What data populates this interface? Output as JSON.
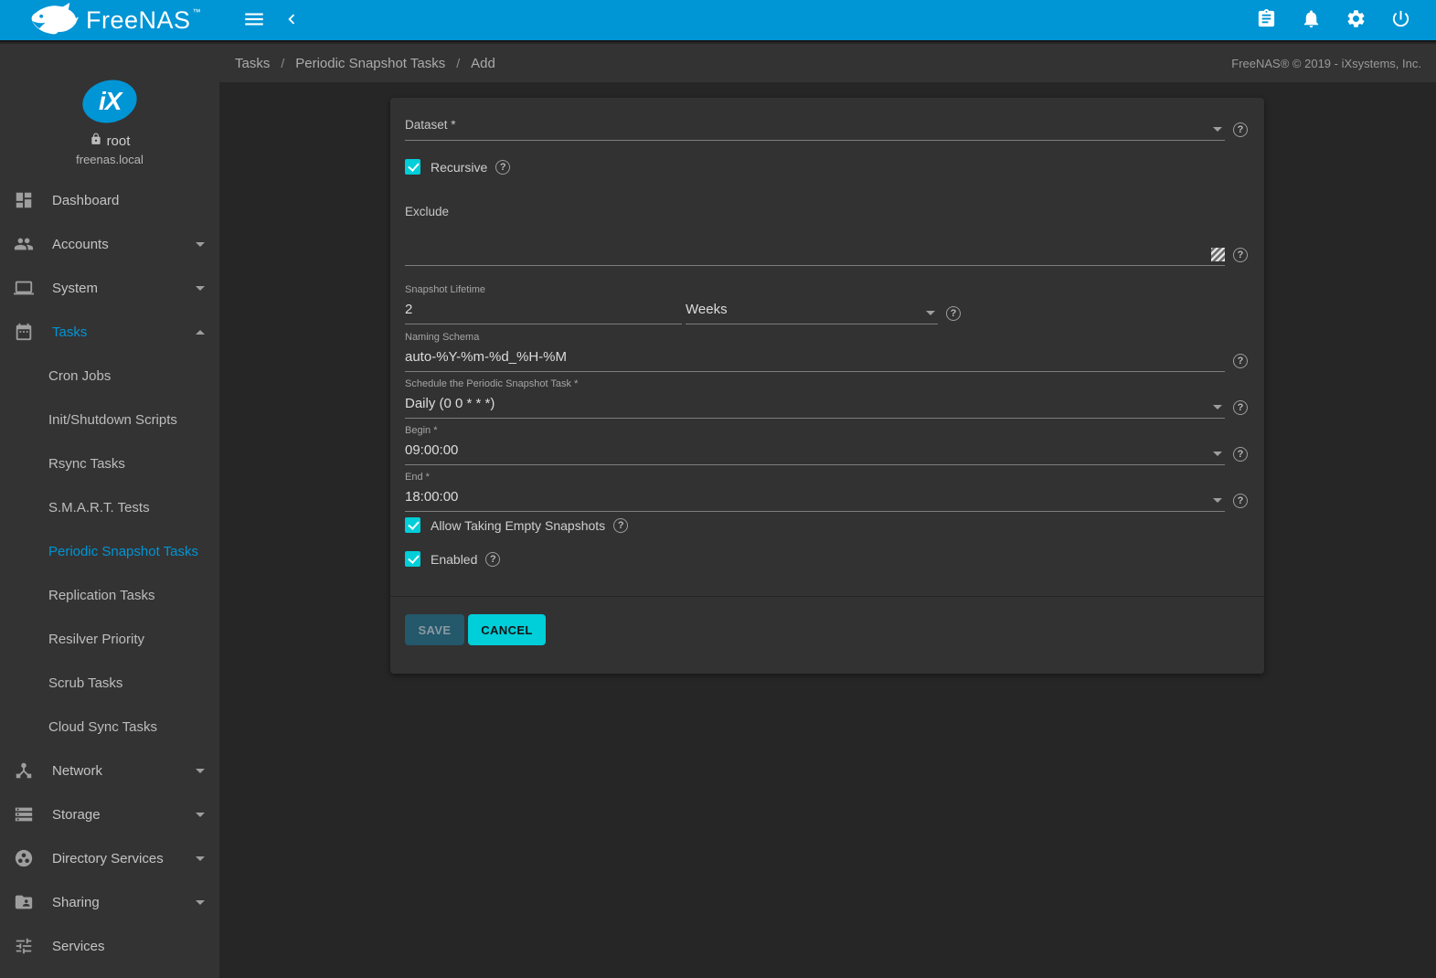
{
  "colors": {
    "header_blue": "#0095d5",
    "accent_cyan": "#00ced9",
    "active_link_blue": "#0095d5",
    "save_disabled_bg": "#24586b",
    "sidebar_bg": "#333333",
    "content_bg": "#262626",
    "card_bg": "#323232"
  },
  "header": {
    "brand": "FreeNAS",
    "brand_tm": "™",
    "icons": [
      "menu",
      "chevron-left",
      "task-manager-clipboard",
      "notifications-bell",
      "settings-gear",
      "power"
    ]
  },
  "breadcrumb": {
    "items": [
      "Tasks",
      "Periodic Snapshot Tasks",
      "Add"
    ],
    "separator": "/",
    "copyright": "FreeNAS® © 2019 - iXsystems, Inc."
  },
  "sidebar": {
    "logo": "iX",
    "user": {
      "name": "root",
      "host": "freenas.local"
    },
    "nav": [
      {
        "label": "Dashboard",
        "icon": "dashboard"
      },
      {
        "label": "Accounts",
        "icon": "people",
        "expandable": true
      },
      {
        "label": "System",
        "icon": "computer",
        "expandable": true
      },
      {
        "label": "Tasks",
        "icon": "calendar",
        "expandable": true,
        "expanded": true,
        "active": true
      },
      {
        "label": "Cron Jobs",
        "sub": true
      },
      {
        "label": "Init/Shutdown Scripts",
        "sub": true
      },
      {
        "label": "Rsync Tasks",
        "sub": true
      },
      {
        "label": "S.M.A.R.T. Tests",
        "sub": true
      },
      {
        "label": "Periodic Snapshot Tasks",
        "sub": true,
        "active": true
      },
      {
        "label": "Replication Tasks",
        "sub": true
      },
      {
        "label": "Resilver Priority",
        "sub": true
      },
      {
        "label": "Scrub Tasks",
        "sub": true
      },
      {
        "label": "Cloud Sync Tasks",
        "sub": true
      },
      {
        "label": "Network",
        "icon": "device-hub",
        "expandable": true
      },
      {
        "label": "Storage",
        "icon": "storage",
        "expandable": true
      },
      {
        "label": "Directory Services",
        "icon": "group-work",
        "expandable": true
      },
      {
        "label": "Sharing",
        "icon": "folder-shared",
        "expandable": true
      },
      {
        "label": "Services",
        "icon": "tune"
      }
    ]
  },
  "form": {
    "dataset": {
      "label": "Dataset *",
      "value": ""
    },
    "recursive": {
      "label": "Recursive",
      "checked": true
    },
    "exclude": {
      "label": "Exclude",
      "value": ""
    },
    "lifetime": {
      "label": "Snapshot Lifetime",
      "value": "2",
      "unit": "Weeks"
    },
    "naming_schema": {
      "label": "Naming Schema",
      "value": "auto-%Y-%m-%d_%H-%M"
    },
    "schedule": {
      "label": "Schedule the Periodic Snapshot Task *",
      "value": "Daily (0 0 * * *)"
    },
    "begin": {
      "label": "Begin *",
      "value": "09:00:00"
    },
    "end": {
      "label": "End *",
      "value": "18:00:00"
    },
    "allow_empty": {
      "label": "Allow Taking Empty Snapshots",
      "checked": true
    },
    "enabled": {
      "label": "Enabled",
      "checked": true
    },
    "buttons": {
      "save": "SAVE",
      "cancel": "CANCEL"
    }
  }
}
